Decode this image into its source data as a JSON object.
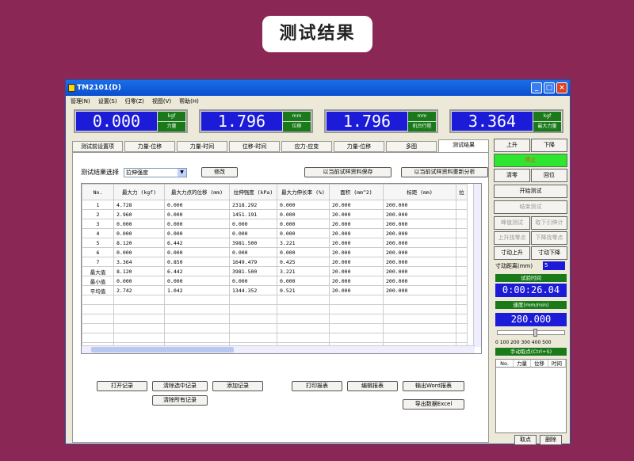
{
  "heading": "测试结果",
  "window": {
    "title": "TM2101(D)",
    "menu": [
      "管理(N)",
      "设置(S)",
      "归零(Z)",
      "视图(V)",
      "帮助(H)"
    ],
    "displays": [
      {
        "value": "0.000",
        "unit": "kgf",
        "label": "力量"
      },
      {
        "value": "1.796",
        "unit": "mm",
        "label": "位移"
      },
      {
        "value": "1.796",
        "unit": "mm",
        "label": "机台行程"
      },
      {
        "value": "3.364",
        "unit": "kgf",
        "label": "最大力量"
      }
    ],
    "tabs": [
      "测试前设置项",
      "力量-位移",
      "力量-时间",
      "位移-时间",
      "应力-应变",
      "力量-位移",
      "多图",
      "测试结果"
    ],
    "active_tab": 7
  },
  "results": {
    "select_label": "测试结果选择",
    "select_value": "拉伸强度",
    "refresh_button": "修改",
    "save_current_button": "以当前试样资料保存",
    "reanalyze_button": "以当前试样资料重新分析",
    "columns": [
      "No.",
      "最大力\n(kgf)",
      "最大力点的位移\n(mm)",
      "拉伸强度\n(kPa)",
      "最大力伸长率\n(%)",
      "面积\n(mm^2)",
      "标距\n(mm)",
      "拉"
    ],
    "rows": [
      [
        "1",
        "4.728",
        "0.000",
        "2318.292",
        "0.000",
        "20.000",
        "200.000",
        ""
      ],
      [
        "2",
        "2.960",
        "0.000",
        "1451.191",
        "0.000",
        "20.000",
        "200.000",
        ""
      ],
      [
        "3",
        "0.000",
        "0.000",
        "0.000",
        "0.000",
        "20.000",
        "200.000",
        ""
      ],
      [
        "4",
        "0.000",
        "0.000",
        "0.000",
        "0.000",
        "20.000",
        "200.000",
        ""
      ],
      [
        "5",
        "8.120",
        "6.442",
        "3981.500",
        "3.221",
        "20.000",
        "200.000",
        ""
      ],
      [
        "6",
        "0.000",
        "0.000",
        "0.000",
        "0.000",
        "20.000",
        "200.000",
        ""
      ],
      [
        "7",
        "3.364",
        "0.850",
        "1649.479",
        "0.425",
        "20.000",
        "200.000",
        ""
      ],
      [
        "最大值",
        "8.120",
        "6.442",
        "3981.500",
        "3.221",
        "20.000",
        "200.000",
        ""
      ],
      [
        "最小值",
        "0.000",
        "0.000",
        "0.000",
        "0.000",
        "20.000",
        "200.000",
        ""
      ],
      [
        "平均值",
        "2.742",
        "1.042",
        "1344.352",
        "0.521",
        "20.000",
        "200.000",
        ""
      ]
    ],
    "empty_rows": 6,
    "buttons": {
      "open": "打开记录",
      "clear_selected": "清除选中记录",
      "add": "添加记录",
      "print": "打印报表",
      "edit_report": "编辑报表",
      "export_word": "输出Word报表",
      "clear_all": "清除所有记录",
      "export_excel": "导出数据Excel"
    }
  },
  "right": {
    "up": "上升",
    "down": "下降",
    "stop": "停止",
    "zero": "清零",
    "home": "回位",
    "start_test": "开始测试",
    "stop_test": "结束测试",
    "peak_test": "峰值测试",
    "pull_out": "取下引伸计",
    "upper_zero": "上升找零点",
    "lower_zero": "下降找零点",
    "jog_up": "寸动上升",
    "jog_down": "寸动下降",
    "jog_distance_label": "寸动距离(mm)",
    "jog_distance_value": "5",
    "test_time_label": "试验时间",
    "test_time": "0:00:26.04",
    "speed_label": "速度(mm/min)",
    "speed": "280.000",
    "speed_fraction": 0.56,
    "speed_scale": "0  100  200  300  400  500",
    "manual_label": "手动取点(Ctrl+S)",
    "manual_cols": [
      "No.",
      "力量",
      "位移",
      "时间"
    ],
    "take_point": "取点",
    "delete": "删除"
  }
}
